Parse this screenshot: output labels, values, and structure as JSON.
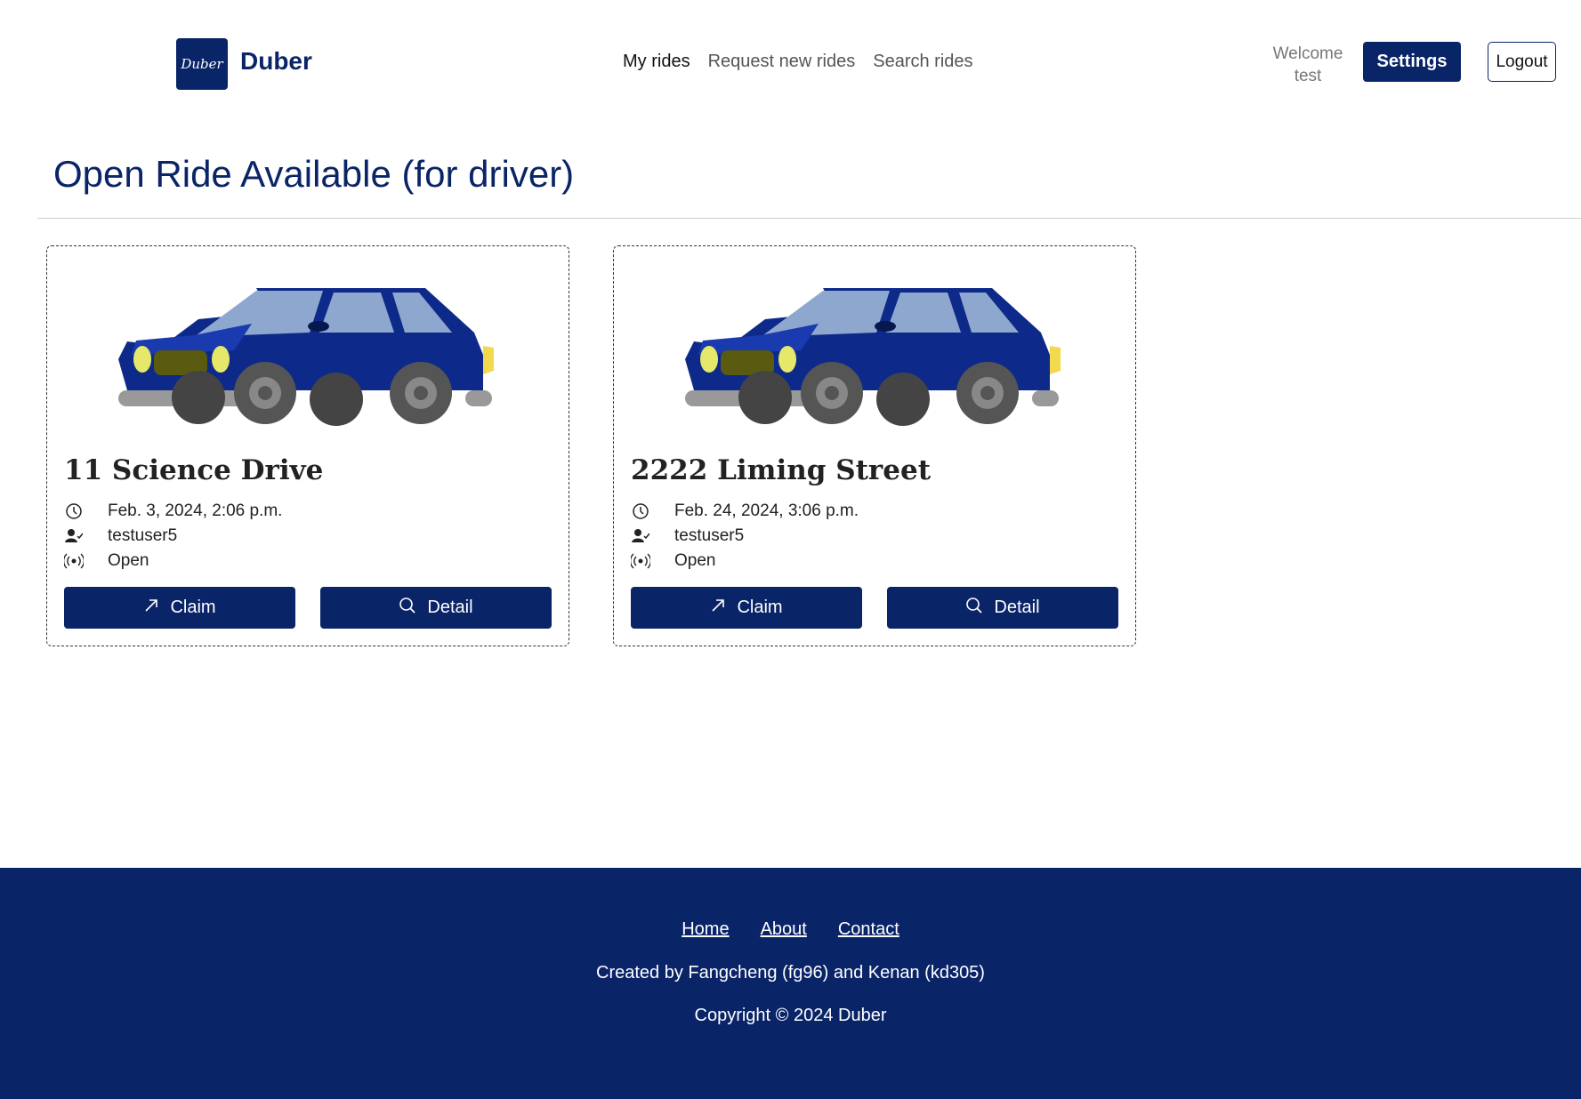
{
  "brand": {
    "logo_text": "Duber",
    "name": "Duber"
  },
  "nav": [
    {
      "label": "My rides",
      "active": true
    },
    {
      "label": "Request new rides",
      "active": false
    },
    {
      "label": "Search rides",
      "active": false
    }
  ],
  "user": {
    "welcome_line1": "Welcome",
    "welcome_line2": "test"
  },
  "header_buttons": {
    "settings": "Settings",
    "logout": "Logout"
  },
  "page_title": "Open Ride Available (for driver)",
  "rides": [
    {
      "title": "11 Science Drive",
      "datetime": "Feb. 3, 2024, 2:06 p.m.",
      "owner": "testuser5",
      "status": "Open",
      "claim_label": "Claim",
      "detail_label": "Detail"
    },
    {
      "title": "2222 Liming Street",
      "datetime": "Feb. 24, 2024, 3:06 p.m.",
      "owner": "testuser5",
      "status": "Open",
      "claim_label": "Claim",
      "detail_label": "Detail"
    }
  ],
  "icons": {
    "time": "clock-icon",
    "owner": "user-check-icon",
    "status": "broadcast-icon",
    "claim": "arrow-up-right-icon",
    "detail": "search-icon"
  },
  "footer": {
    "links": [
      "Home",
      "About",
      "Contact"
    ],
    "credits": "Created by Fangcheng (fg96) and Kenan (kd305)",
    "copyright": "Copyright © 2024 Duber"
  },
  "colors": {
    "primary": "#0a2468",
    "car_body": "#0d2a8a",
    "headlight": "#e6e86a"
  }
}
